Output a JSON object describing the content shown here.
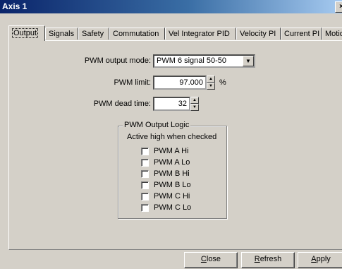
{
  "window": {
    "title": "Axis 1",
    "close_glyph": "×"
  },
  "tabs": [
    {
      "label": "Output"
    },
    {
      "label": "Signals"
    },
    {
      "label": "Safety"
    },
    {
      "label": "Commutation"
    },
    {
      "label": "Vel Integrator PID"
    },
    {
      "label": "Velocity PI"
    },
    {
      "label": "Current PI"
    },
    {
      "label": "Motion"
    }
  ],
  "form": {
    "pwm_mode_label": "PWM output mode:",
    "pwm_mode_value": "PWM 6 signal 50-50",
    "pwm_limit_label": "PWM limit:",
    "pwm_limit_value": "97.000",
    "pwm_limit_unit": "%",
    "dead_time_label": "PWM dead time:",
    "dead_time_value": "32"
  },
  "logic": {
    "legend": "PWM Output Logic",
    "caption": "Active high when checked",
    "items": [
      {
        "label": "PWM A Hi",
        "checked": false
      },
      {
        "label": "PWM A Lo",
        "checked": false
      },
      {
        "label": "PWM B Hi",
        "checked": false
      },
      {
        "label": "PWM B Lo",
        "checked": false
      },
      {
        "label": "PWM C Hi",
        "checked": false
      },
      {
        "label": "PWM C Lo",
        "checked": false
      }
    ]
  },
  "buttons": {
    "close": {
      "first": "C",
      "rest": "lose"
    },
    "refresh": {
      "first": "R",
      "rest": "efresh"
    },
    "apply": {
      "first": "A",
      "rest": "pply"
    }
  },
  "icons": {
    "dropdown": "chevron-down-icon",
    "spin_up": "arrow-up-icon",
    "spin_down": "arrow-down-icon"
  }
}
